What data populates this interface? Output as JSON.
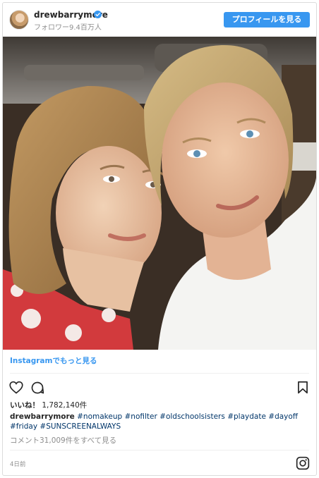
{
  "header": {
    "username": "drewbarrymore",
    "followers": "フォロワー9.4百万人",
    "profile_button": "プロフィールを見る"
  },
  "post": {
    "view_more_link": "Instagramでもっと見る",
    "likes_label": "いいね！",
    "likes_count": "1,782,140件",
    "caption_user": "drewbarrymore",
    "hashtags": [
      "#nomakeup",
      "#nofilter",
      "#oldschoolsisters",
      "#playdate",
      "#dayoff",
      "#friday",
      "#SUNSCREENALWAYS"
    ],
    "comments_link": "コメント31,009件をすべて見る",
    "timestamp": "4日前"
  },
  "icons": {
    "verified": "verified-badge-icon",
    "like": "heart-icon",
    "comment": "comment-icon",
    "save": "bookmark-icon",
    "brand": "instagram-icon"
  },
  "colors": {
    "accent": "#3897f0",
    "hashtag": "#003569",
    "muted": "#8e8e8e",
    "text": "#262626"
  }
}
